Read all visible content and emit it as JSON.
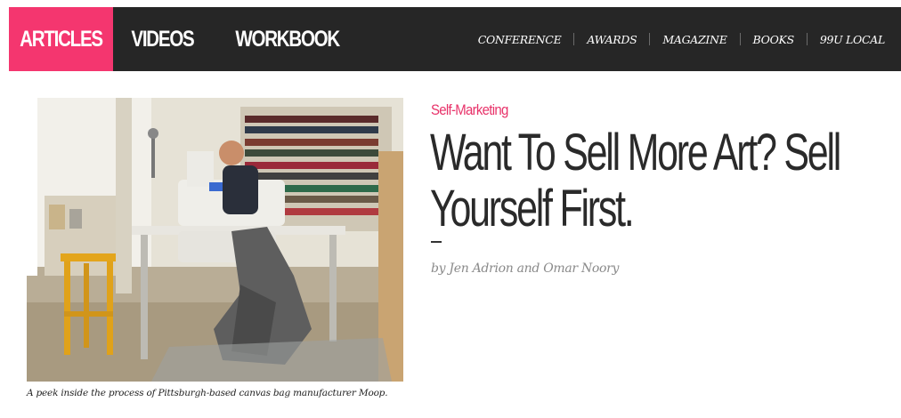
{
  "nav": {
    "main": [
      {
        "label": "ARTICLES",
        "active": true
      },
      {
        "label": "VIDEOS",
        "active": false
      },
      {
        "label": "WORKBOOK",
        "active": false
      }
    ],
    "secondary": [
      "CONFERENCE",
      "AWARDS",
      "MAGAZINE",
      "BOOKS",
      "99U LOCAL"
    ]
  },
  "article": {
    "category": "Self-Marketing",
    "title": "Want To Sell More Art? Sell Yourself First.",
    "byline": "by Jen Adrion and Omar Noory",
    "image_caption": "A peek inside the process of Pittsburgh-based canvas bag manufacturer Moop."
  },
  "colors": {
    "accent": "#f4366f",
    "navbar": "#262626",
    "headline": "#2a2a2a",
    "byline": "#8a8a8a"
  }
}
